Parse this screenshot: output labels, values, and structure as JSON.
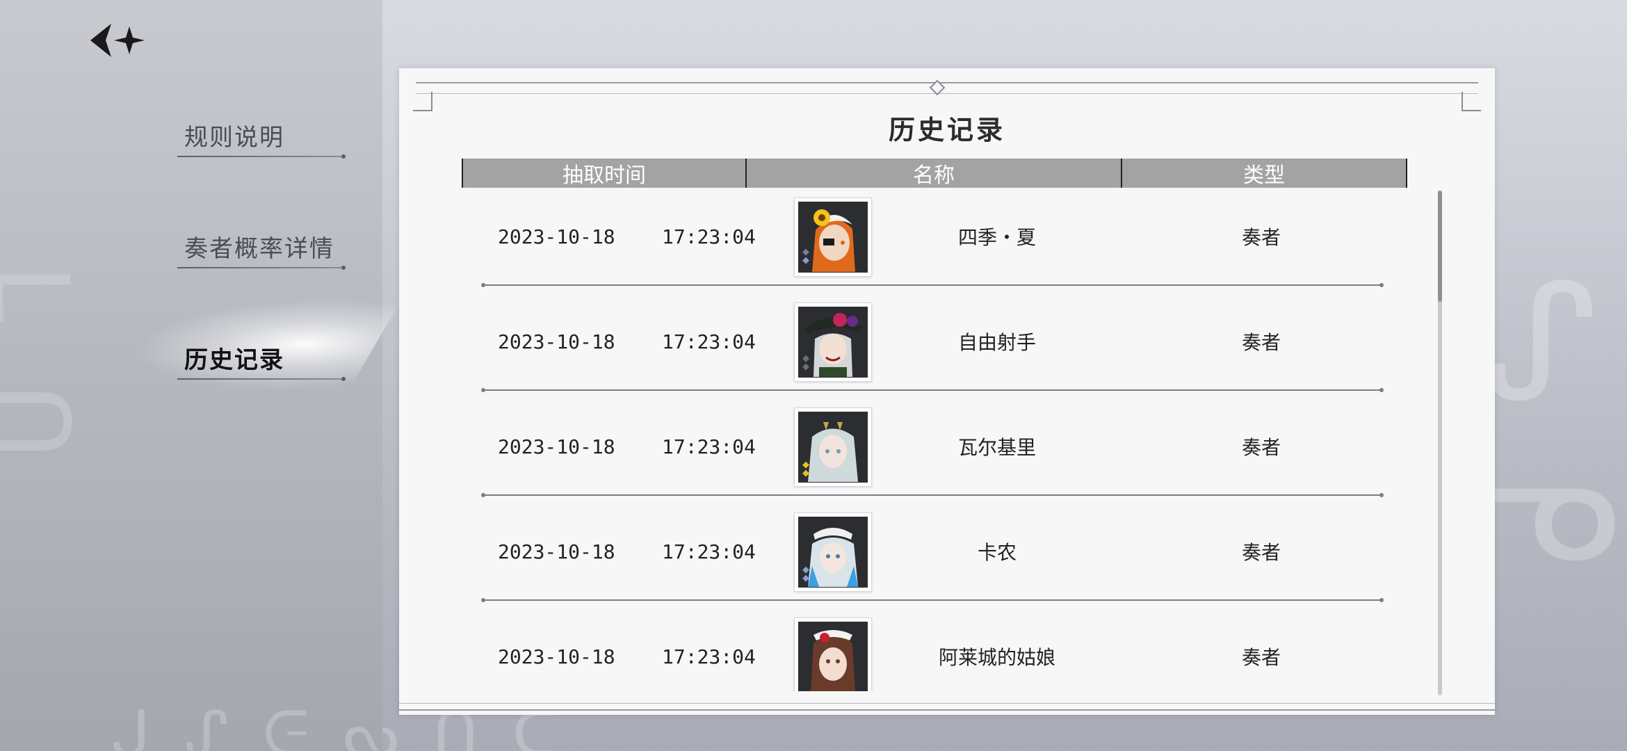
{
  "nav": {
    "items": [
      {
        "label": "规则说明",
        "active": false
      },
      {
        "label": "奏者概率详情",
        "active": false
      },
      {
        "label": "历史记录",
        "active": true
      }
    ]
  },
  "modal": {
    "title": "历史记录",
    "columns": [
      "抽取时间",
      "名称",
      "类型"
    ],
    "rows": [
      {
        "time": "2023-10-18    17:23:04",
        "name": "四季・夏",
        "type": "奏者"
      },
      {
        "time": "2023-10-18    17:23:04",
        "name": "自由射手",
        "type": "奏者"
      },
      {
        "time": "2023-10-18    17:23:04",
        "name": "瓦尔基里",
        "type": "奏者"
      },
      {
        "time": "2023-10-18    17:23:04",
        "name": "卡农",
        "type": "奏者"
      },
      {
        "time": "2023-10-18    17:23:04",
        "name": "阿莱城的姑娘",
        "type": "奏者"
      }
    ]
  },
  "icons": {
    "back": "back-arrow-star-icon"
  },
  "colors": {
    "header_bg": "#a3a3a3",
    "panel_bg": "#f7f7f8",
    "divider": "#7b7e88",
    "text": "#222222"
  }
}
